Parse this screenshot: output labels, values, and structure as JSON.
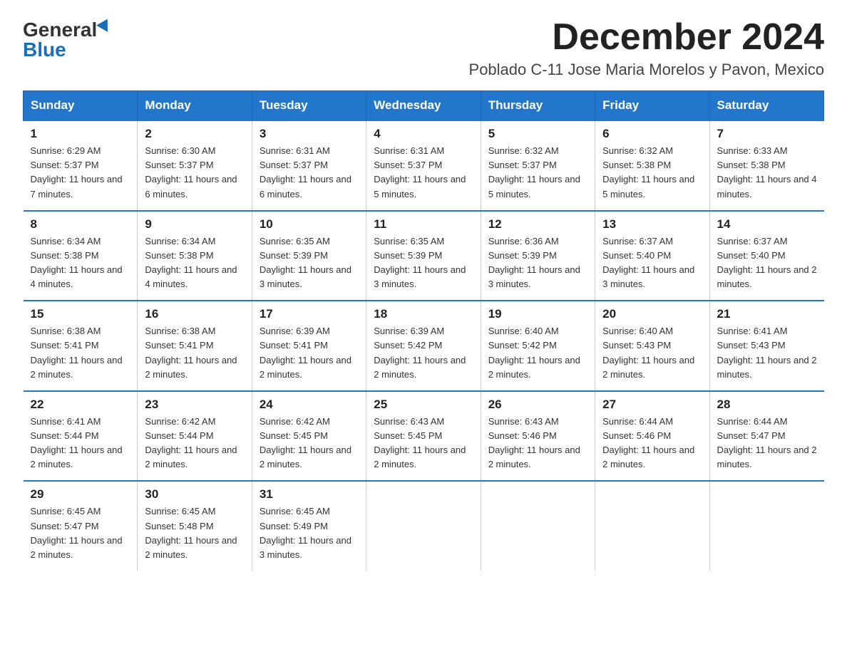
{
  "logo": {
    "general": "General",
    "blue": "Blue"
  },
  "title": "December 2024",
  "subtitle": "Poblado C-11 Jose Maria Morelos y Pavon, Mexico",
  "days_of_week": [
    "Sunday",
    "Monday",
    "Tuesday",
    "Wednesday",
    "Thursday",
    "Friday",
    "Saturday"
  ],
  "weeks": [
    [
      {
        "day": "1",
        "sunrise": "6:29 AM",
        "sunset": "5:37 PM",
        "daylight": "11 hours and 7 minutes."
      },
      {
        "day": "2",
        "sunrise": "6:30 AM",
        "sunset": "5:37 PM",
        "daylight": "11 hours and 6 minutes."
      },
      {
        "day": "3",
        "sunrise": "6:31 AM",
        "sunset": "5:37 PM",
        "daylight": "11 hours and 6 minutes."
      },
      {
        "day": "4",
        "sunrise": "6:31 AM",
        "sunset": "5:37 PM",
        "daylight": "11 hours and 5 minutes."
      },
      {
        "day": "5",
        "sunrise": "6:32 AM",
        "sunset": "5:37 PM",
        "daylight": "11 hours and 5 minutes."
      },
      {
        "day": "6",
        "sunrise": "6:32 AM",
        "sunset": "5:38 PM",
        "daylight": "11 hours and 5 minutes."
      },
      {
        "day": "7",
        "sunrise": "6:33 AM",
        "sunset": "5:38 PM",
        "daylight": "11 hours and 4 minutes."
      }
    ],
    [
      {
        "day": "8",
        "sunrise": "6:34 AM",
        "sunset": "5:38 PM",
        "daylight": "11 hours and 4 minutes."
      },
      {
        "day": "9",
        "sunrise": "6:34 AM",
        "sunset": "5:38 PM",
        "daylight": "11 hours and 4 minutes."
      },
      {
        "day": "10",
        "sunrise": "6:35 AM",
        "sunset": "5:39 PM",
        "daylight": "11 hours and 3 minutes."
      },
      {
        "day": "11",
        "sunrise": "6:35 AM",
        "sunset": "5:39 PM",
        "daylight": "11 hours and 3 minutes."
      },
      {
        "day": "12",
        "sunrise": "6:36 AM",
        "sunset": "5:39 PM",
        "daylight": "11 hours and 3 minutes."
      },
      {
        "day": "13",
        "sunrise": "6:37 AM",
        "sunset": "5:40 PM",
        "daylight": "11 hours and 3 minutes."
      },
      {
        "day": "14",
        "sunrise": "6:37 AM",
        "sunset": "5:40 PM",
        "daylight": "11 hours and 2 minutes."
      }
    ],
    [
      {
        "day": "15",
        "sunrise": "6:38 AM",
        "sunset": "5:41 PM",
        "daylight": "11 hours and 2 minutes."
      },
      {
        "day": "16",
        "sunrise": "6:38 AM",
        "sunset": "5:41 PM",
        "daylight": "11 hours and 2 minutes."
      },
      {
        "day": "17",
        "sunrise": "6:39 AM",
        "sunset": "5:41 PM",
        "daylight": "11 hours and 2 minutes."
      },
      {
        "day": "18",
        "sunrise": "6:39 AM",
        "sunset": "5:42 PM",
        "daylight": "11 hours and 2 minutes."
      },
      {
        "day": "19",
        "sunrise": "6:40 AM",
        "sunset": "5:42 PM",
        "daylight": "11 hours and 2 minutes."
      },
      {
        "day": "20",
        "sunrise": "6:40 AM",
        "sunset": "5:43 PM",
        "daylight": "11 hours and 2 minutes."
      },
      {
        "day": "21",
        "sunrise": "6:41 AM",
        "sunset": "5:43 PM",
        "daylight": "11 hours and 2 minutes."
      }
    ],
    [
      {
        "day": "22",
        "sunrise": "6:41 AM",
        "sunset": "5:44 PM",
        "daylight": "11 hours and 2 minutes."
      },
      {
        "day": "23",
        "sunrise": "6:42 AM",
        "sunset": "5:44 PM",
        "daylight": "11 hours and 2 minutes."
      },
      {
        "day": "24",
        "sunrise": "6:42 AM",
        "sunset": "5:45 PM",
        "daylight": "11 hours and 2 minutes."
      },
      {
        "day": "25",
        "sunrise": "6:43 AM",
        "sunset": "5:45 PM",
        "daylight": "11 hours and 2 minutes."
      },
      {
        "day": "26",
        "sunrise": "6:43 AM",
        "sunset": "5:46 PM",
        "daylight": "11 hours and 2 minutes."
      },
      {
        "day": "27",
        "sunrise": "6:44 AM",
        "sunset": "5:46 PM",
        "daylight": "11 hours and 2 minutes."
      },
      {
        "day": "28",
        "sunrise": "6:44 AM",
        "sunset": "5:47 PM",
        "daylight": "11 hours and 2 minutes."
      }
    ],
    [
      {
        "day": "29",
        "sunrise": "6:45 AM",
        "sunset": "5:47 PM",
        "daylight": "11 hours and 2 minutes."
      },
      {
        "day": "30",
        "sunrise": "6:45 AM",
        "sunset": "5:48 PM",
        "daylight": "11 hours and 2 minutes."
      },
      {
        "day": "31",
        "sunrise": "6:45 AM",
        "sunset": "5:49 PM",
        "daylight": "11 hours and 3 minutes."
      },
      null,
      null,
      null,
      null
    ]
  ]
}
